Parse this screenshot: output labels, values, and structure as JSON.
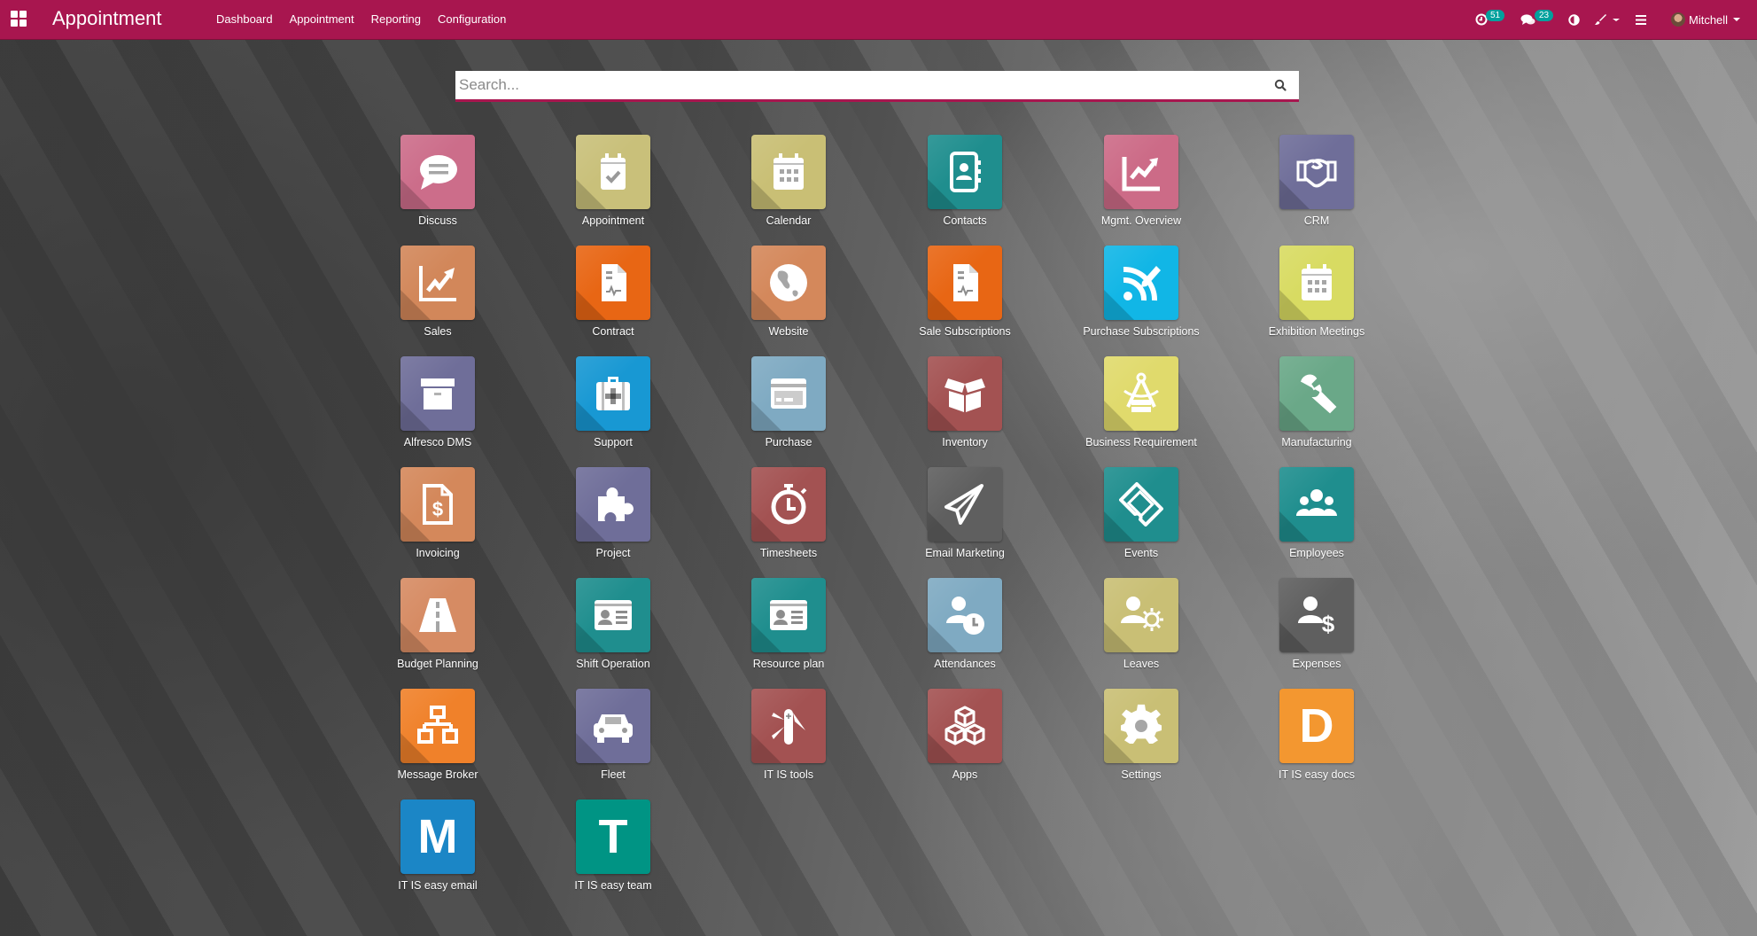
{
  "navbar": {
    "app_title": "Appointment",
    "menu": [
      "Dashboard",
      "Appointment",
      "Reporting",
      "Configuration"
    ],
    "activity_count": "51",
    "messages_count": "23",
    "user_name": "Mitchell",
    "color": "#a8164f"
  },
  "search": {
    "placeholder": "Search...",
    "value": ""
  },
  "apps": [
    {
      "label": "Discuss",
      "icon": "chat-bubble-icon",
      "color": "#cc6d8a"
    },
    {
      "label": "Appointment",
      "icon": "calendar-check-icon",
      "color": "#c9c07a"
    },
    {
      "label": "Calendar",
      "icon": "calendar-icon",
      "color": "#c9bf75"
    },
    {
      "label": "Contacts",
      "icon": "address-book-icon",
      "color": "#1f8e8e"
    },
    {
      "label": "Mgmt. Overview",
      "icon": "line-chart-icon",
      "color": "#cc6b87"
    },
    {
      "label": "CRM",
      "icon": "handshake-icon",
      "color": "#6f6e99"
    },
    {
      "label": "Sales",
      "icon": "sales-chart-icon",
      "color": "#d2875a"
    },
    {
      "label": "Contract",
      "icon": "contract-document-icon",
      "color": "#e86614"
    },
    {
      "label": "Website",
      "icon": "globe-icon",
      "color": "#d4885b"
    },
    {
      "label": "Sale Subscriptions",
      "icon": "contract-document-icon",
      "color": "#e86614"
    },
    {
      "label": "Purchase Subscriptions",
      "icon": "rss-pencil-icon",
      "color": "#11b6e6"
    },
    {
      "label": "Exhibition Meetings",
      "icon": "calendar-icon",
      "color": "#d8db62"
    },
    {
      "label": "Alfresco DMS",
      "icon": "archive-box-icon",
      "color": "#6f6e99"
    },
    {
      "label": "Support",
      "icon": "medkit-icon",
      "color": "#1898d3"
    },
    {
      "label": "Purchase",
      "icon": "credit-card-icon",
      "color": "#7faac2"
    },
    {
      "label": "Inventory",
      "icon": "open-box-icon",
      "color": "#a35252"
    },
    {
      "label": "Business Requirement",
      "icon": "compass-drafting-icon",
      "color": "#e0da6c"
    },
    {
      "label": "Manufacturing",
      "icon": "wrench-icon",
      "color": "#6aa888"
    },
    {
      "label": "Invoicing",
      "icon": "invoice-dollar-icon",
      "color": "#d4885b"
    },
    {
      "label": "Project",
      "icon": "puzzle-piece-icon",
      "color": "#6f6e99"
    },
    {
      "label": "Timesheets",
      "icon": "stopwatch-icon",
      "color": "#a35252"
    },
    {
      "label": "Email Marketing",
      "icon": "paper-plane-icon",
      "color": "#5f5f5f"
    },
    {
      "label": "Events",
      "icon": "ticket-icon",
      "color": "#1f8e8e"
    },
    {
      "label": "Employees",
      "icon": "users-icon",
      "color": "#1f8e8e"
    },
    {
      "label": "Budget Planning",
      "icon": "road-icon",
      "color": "#d68b63"
    },
    {
      "label": "Shift Operation",
      "icon": "id-card-icon",
      "color": "#1f8e8e"
    },
    {
      "label": "Resource plan",
      "icon": "id-card-icon",
      "color": "#1f8e8e"
    },
    {
      "label": "Attendances",
      "icon": "user-clock-icon",
      "color": "#7faac2"
    },
    {
      "label": "Leaves",
      "icon": "user-sun-icon",
      "color": "#c9bf75"
    },
    {
      "label": "Expenses",
      "icon": "user-dollar-icon",
      "color": "#5f5f5f"
    },
    {
      "label": "Message Broker",
      "icon": "sitemap-icon",
      "color": "#f0812a"
    },
    {
      "label": "Fleet",
      "icon": "car-icon",
      "color": "#6f6e99"
    },
    {
      "label": "IT IS tools",
      "icon": "swiss-knife-icon",
      "color": "#a35252"
    },
    {
      "label": "Apps",
      "icon": "cubes-icon",
      "color": "#a35252"
    },
    {
      "label": "Settings",
      "icon": "gear-icon",
      "color": "#c9bf75"
    },
    {
      "label": "IT IS easy docs",
      "icon": "letter-d-icon",
      "letter": "D",
      "color": "#f39730"
    },
    {
      "label": "IT IS easy email",
      "icon": "letter-m-icon",
      "letter": "M",
      "color": "#1b86c6"
    },
    {
      "label": "IT IS easy team",
      "icon": "letter-t-icon",
      "letter": "T",
      "color": "#009484"
    }
  ]
}
